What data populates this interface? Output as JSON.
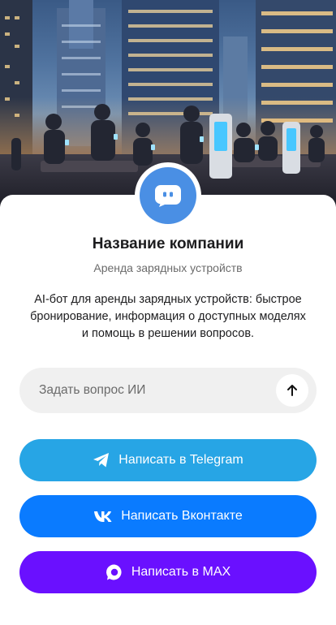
{
  "profile": {
    "company_name": "Название компании",
    "subtitle": "Аренда зарядных устройств",
    "description": "AI-бот для аренды зарядных устройств: быстрое бронирование, информация о доступных моделях и помощь в решении вопросов.",
    "avatar_icon": "chat-bot-icon",
    "avatar_color": "#4a8fe4"
  },
  "ask": {
    "placeholder": "Задать вопрос ИИ",
    "send_icon": "arrow-up-icon"
  },
  "buttons": [
    {
      "label": "Написать в Telegram",
      "icon": "telegram-icon",
      "color": "#27a5e5"
    },
    {
      "label": "Написать Вконтакте",
      "icon": "vk-icon",
      "color": "#0a7bff"
    },
    {
      "label": "Написать в MAX",
      "icon": "max-icon",
      "color": "#6a10ff"
    }
  ]
}
